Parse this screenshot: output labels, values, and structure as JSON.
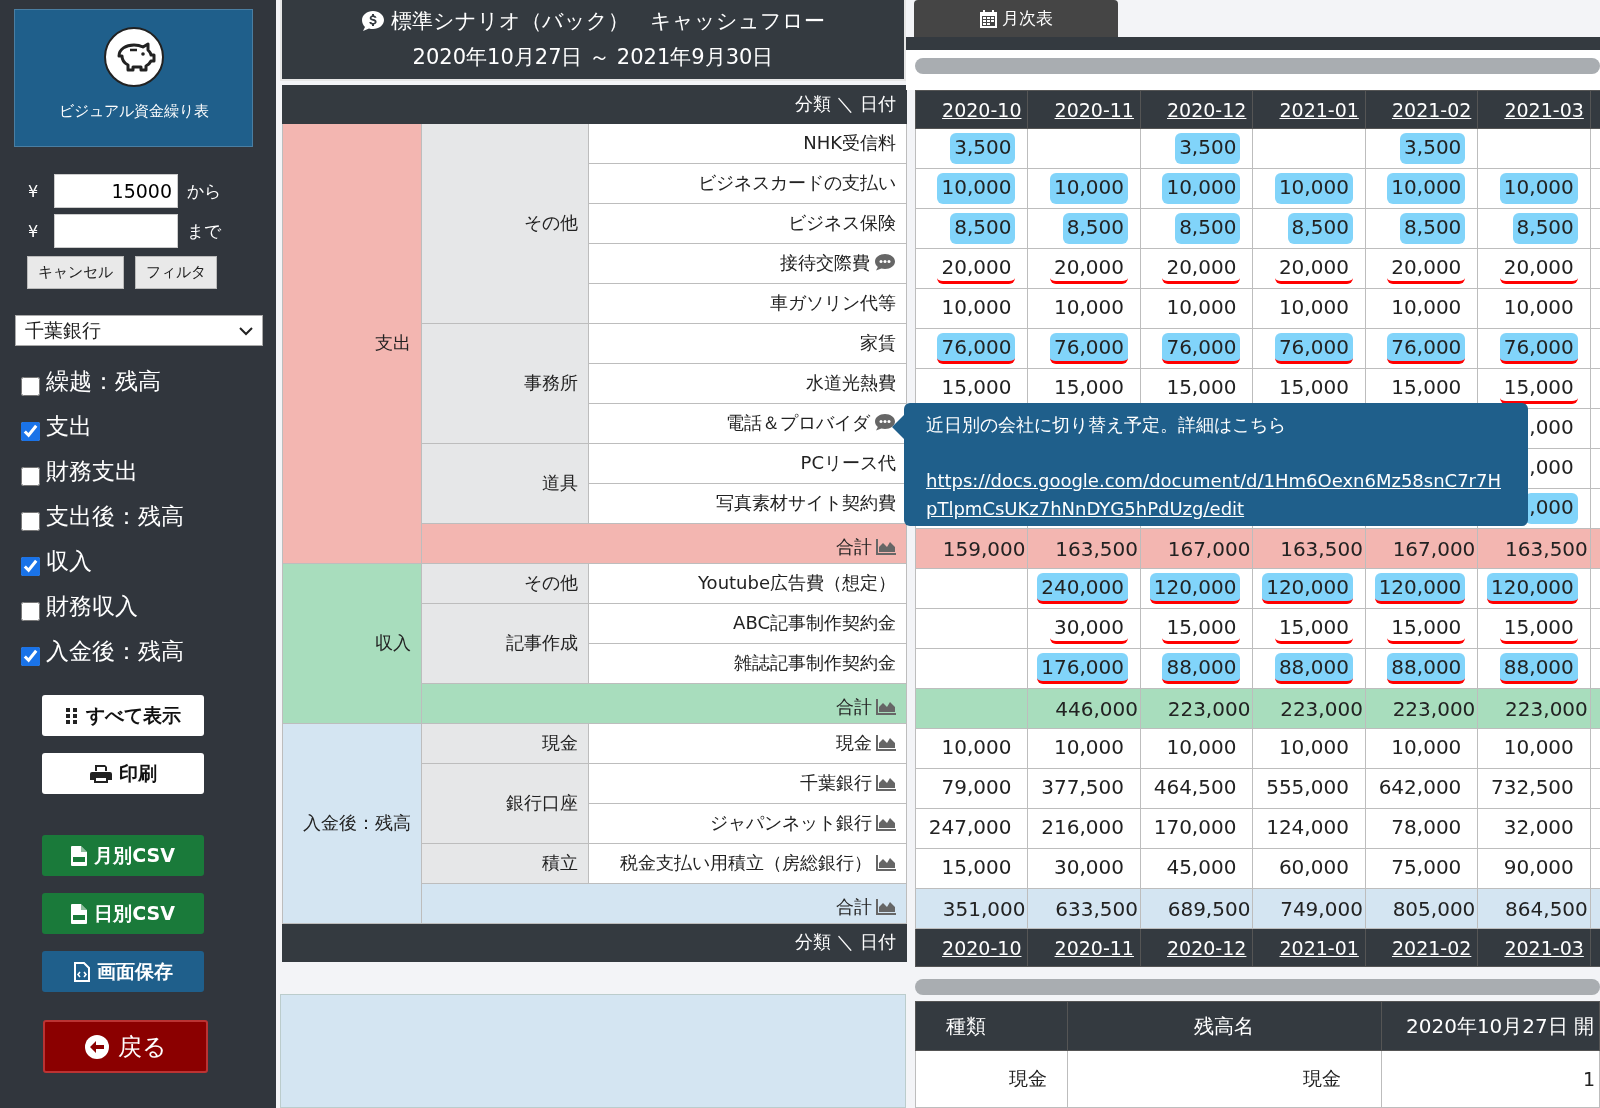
{
  "sidebar": {
    "logo": {
      "title": "ビジュアル資金繰り表"
    },
    "filter": {
      "fields": [
        {
          "currency": "¥",
          "value": "15000",
          "suffix": "から"
        },
        {
          "currency": "¥",
          "suffix": "まで"
        }
      ],
      "buttons": [
        "キャンセル",
        "フィルタ"
      ]
    },
    "account_select": {
      "value": "千葉銀行"
    },
    "checkboxes": [
      {
        "label": "繰越：残高",
        "checked": false
      },
      {
        "label": "支出",
        "checked": true
      },
      {
        "label": "財務支出",
        "checked": false
      },
      {
        "label": "支出後：残高",
        "checked": false
      },
      {
        "label": "収入",
        "checked": true
      },
      {
        "label": "財務収入",
        "checked": false
      },
      {
        "label": "入金後：残高",
        "checked": true
      }
    ],
    "actions": [
      {
        "label": "すべて表示",
        "kind": "light"
      },
      {
        "label": "印刷",
        "kind": "light"
      },
      {
        "label": "月別CSV",
        "kind": "success"
      },
      {
        "label": "日別CSV",
        "kind": "success"
      },
      {
        "label": "画面保存",
        "kind": "primary"
      }
    ],
    "back_button": {
      "label": "戻る"
    }
  },
  "header": {
    "title": "標準シナリオ（バック）　キャッシュフロー",
    "period": "2020年10月27日 ～ 2021年9月30日"
  },
  "tabs": [
    {
      "label": "月次表",
      "selected": true
    }
  ],
  "table": {
    "corner": "分類 ＼ 日付",
    "columns": [
      "2020-10",
      "2020-11",
      "2020-12",
      "2021-01",
      "2021-02",
      "2021-03"
    ],
    "footer_corner": "分類 ＼ 日付",
    "footer_columns": [
      "2020-10",
      "2020-11",
      "2020-12",
      "2021-01",
      "2021-02",
      "2021-03"
    ],
    "sections": [
      {
        "label": "支出",
        "kind": "expense",
        "groups": [
          {
            "label": "その他",
            "items": [
              {
                "label": "NHK受信料",
                "cells": [
                  {
                    "text": "3,500",
                    "highlighted": true,
                    "underlined": false
                  },
                  null,
                  {
                    "text": "3,500",
                    "highlighted": true,
                    "underlined": false
                  },
                  null,
                  {
                    "text": "3,500",
                    "highlighted": true,
                    "underlined": false
                  },
                  null
                ]
              },
              {
                "label": "ビジネスカードの支払い",
                "cells": [
                  {
                    "text": "10,000",
                    "highlighted": true,
                    "underlined": false
                  },
                  {
                    "text": "10,000",
                    "highlighted": true,
                    "underlined": false
                  },
                  {
                    "text": "10,000",
                    "highlighted": true,
                    "underlined": false
                  },
                  {
                    "text": "10,000",
                    "highlighted": true,
                    "underlined": false
                  },
                  {
                    "text": "10,000",
                    "highlighted": true,
                    "underlined": false
                  },
                  {
                    "text": "10,000",
                    "highlighted": true,
                    "underlined": false
                  }
                ]
              },
              {
                "label": "ビジネス保険",
                "cells": [
                  {
                    "text": "8,500",
                    "highlighted": true,
                    "underlined": false
                  },
                  {
                    "text": "8,500",
                    "highlighted": true,
                    "underlined": false
                  },
                  {
                    "text": "8,500",
                    "highlighted": true,
                    "underlined": false
                  },
                  {
                    "text": "8,500",
                    "highlighted": true,
                    "underlined": false
                  },
                  {
                    "text": "8,500",
                    "highlighted": true,
                    "underlined": false
                  },
                  {
                    "text": "8,500",
                    "highlighted": true,
                    "underlined": false
                  }
                ]
              },
              {
                "label": "接待交際費",
                "kind": "comment",
                "cells": [
                  {
                    "text": "20,000",
                    "highlighted": false,
                    "underlined": true
                  },
                  {
                    "text": "20,000",
                    "highlighted": false,
                    "underlined": true
                  },
                  {
                    "text": "20,000",
                    "highlighted": false,
                    "underlined": true
                  },
                  {
                    "text": "20,000",
                    "highlighted": false,
                    "underlined": true
                  },
                  {
                    "text": "20,000",
                    "highlighted": false,
                    "underlined": true
                  },
                  {
                    "text": "20,000",
                    "highlighted": false,
                    "underlined": true
                  }
                ]
              },
              {
                "label": "車ガソリン代等",
                "cells": [
                  {
                    "text": "10,000",
                    "highlighted": false,
                    "underlined": false
                  },
                  {
                    "text": "10,000",
                    "highlighted": false,
                    "underlined": false
                  },
                  {
                    "text": "10,000",
                    "highlighted": false,
                    "underlined": false
                  },
                  {
                    "text": "10,000",
                    "highlighted": false,
                    "underlined": false
                  },
                  {
                    "text": "10,000",
                    "highlighted": false,
                    "underlined": false
                  },
                  {
                    "text": "10,000",
                    "highlighted": false,
                    "underlined": false
                  }
                ]
              }
            ]
          },
          {
            "label": "事務所",
            "items": [
              {
                "label": "家賃",
                "cells": [
                  {
                    "text": "76,000",
                    "highlighted": true,
                    "underlined": true
                  },
                  {
                    "text": "76,000",
                    "highlighted": true,
                    "underlined": true
                  },
                  {
                    "text": "76,000",
                    "highlighted": true,
                    "underlined": true
                  },
                  {
                    "text": "76,000",
                    "highlighted": true,
                    "underlined": true
                  },
                  {
                    "text": "76,000",
                    "highlighted": true,
                    "underlined": true
                  },
                  {
                    "text": "76,000",
                    "highlighted": true,
                    "underlined": true
                  }
                ]
              },
              {
                "label": "水道光熱費",
                "cells": [
                  {
                    "text": "15,000",
                    "highlighted": false,
                    "underlined": false
                  },
                  {
                    "text": "15,000",
                    "highlighted": false,
                    "underlined": false
                  },
                  {
                    "text": "15,000",
                    "highlighted": false,
                    "underlined": false
                  },
                  {
                    "text": "15,000",
                    "highlighted": false,
                    "underlined": false
                  },
                  {
                    "text": "15,000",
                    "highlighted": false,
                    "underlined": false
                  },
                  {
                    "text": "15,000",
                    "highlighted": false,
                    "underlined": true
                  }
                ]
              },
              {
                "label": "電話＆プロバイダ",
                "kind": "comment",
                "cells": [
                  null,
                  null,
                  null,
                  null,
                  null,
                  {
                    "text": ",000",
                    "highlighted": false,
                    "underlined": false
                  }
                ]
              }
            ]
          },
          {
            "label": "道具",
            "items": [
              {
                "label": "PCリース代",
                "cells": [
                  null,
                  null,
                  null,
                  null,
                  null,
                  {
                    "text": ",000",
                    "highlighted": false,
                    "underlined": false
                  }
                ]
              },
              {
                "label": "写真素材サイト契約費",
                "cells": [
                  null,
                  null,
                  null,
                  null,
                  null,
                  {
                    "text": ",000",
                    "highlighted": true,
                    "underlined": false
                  }
                ]
              }
            ]
          }
        ],
        "total": {
          "label": "合計",
          "cells": [
            "159,000",
            "163,500",
            "167,000",
            "163,500",
            "167,000",
            "163,500"
          ]
        }
      },
      {
        "label": "収入",
        "kind": "income",
        "groups": [
          {
            "label": "その他",
            "items": [
              {
                "label": "Youtube広告費（想定）",
                "cells": [
                  null,
                  {
                    "text": "240,000",
                    "highlighted": true,
                    "underlined": true
                  },
                  {
                    "text": "120,000",
                    "highlighted": true,
                    "underlined": true
                  },
                  {
                    "text": "120,000",
                    "highlighted": true,
                    "underlined": true
                  },
                  {
                    "text": "120,000",
                    "highlighted": true,
                    "underlined": true
                  },
                  {
                    "text": "120,000",
                    "highlighted": true,
                    "underlined": true
                  }
                ]
              }
            ]
          },
          {
            "label": "記事作成",
            "items": [
              {
                "label": "ABC記事制作契約金",
                "cells": [
                  null,
                  {
                    "text": "30,000",
                    "highlighted": false,
                    "underlined": true
                  },
                  {
                    "text": "15,000",
                    "highlighted": false,
                    "underlined": true
                  },
                  {
                    "text": "15,000",
                    "highlighted": false,
                    "underlined": true
                  },
                  {
                    "text": "15,000",
                    "highlighted": false,
                    "underlined": true
                  },
                  {
                    "text": "15,000",
                    "highlighted": false,
                    "underlined": true
                  }
                ]
              },
              {
                "label": "雑誌記事制作契約金",
                "cells": [
                  null,
                  {
                    "text": "176,000",
                    "highlighted": true,
                    "underlined": true
                  },
                  {
                    "text": "88,000",
                    "highlighted": true,
                    "underlined": true
                  },
                  {
                    "text": "88,000",
                    "highlighted": true,
                    "underlined": true
                  },
                  {
                    "text": "88,000",
                    "highlighted": true,
                    "underlined": true
                  },
                  {
                    "text": "88,000",
                    "highlighted": true,
                    "underlined": true
                  }
                ]
              }
            ]
          }
        ],
        "total": {
          "label": "合計",
          "cells": [
            null,
            "446,000",
            "223,000",
            "223,000",
            "223,000",
            "223,000"
          ]
        }
      },
      {
        "label": "入金後：残高",
        "kind": "balance",
        "groups": [
          {
            "label": "現金",
            "items": [
              {
                "label": "現金",
                "kind": "chart",
                "cells": [
                  {
                    "text": "10,000",
                    "highlighted": false,
                    "underlined": false
                  },
                  {
                    "text": "10,000",
                    "highlighted": false,
                    "underlined": false
                  },
                  {
                    "text": "10,000",
                    "highlighted": false,
                    "underlined": false
                  },
                  {
                    "text": "10,000",
                    "highlighted": false,
                    "underlined": false
                  },
                  {
                    "text": "10,000",
                    "highlighted": false,
                    "underlined": false
                  },
                  {
                    "text": "10,000",
                    "highlighted": false,
                    "underlined": false
                  }
                ]
              }
            ]
          },
          {
            "label": "銀行口座",
            "items": [
              {
                "label": "千葉銀行",
                "kind": "chart",
                "cells": [
                  {
                    "text": "79,000",
                    "highlighted": false,
                    "underlined": false
                  },
                  {
                    "text": "377,500",
                    "highlighted": false,
                    "underlined": false
                  },
                  {
                    "text": "464,500",
                    "highlighted": false,
                    "underlined": false
                  },
                  {
                    "text": "555,000",
                    "highlighted": false,
                    "underlined": false
                  },
                  {
                    "text": "642,000",
                    "highlighted": false,
                    "underlined": false
                  },
                  {
                    "text": "732,500",
                    "highlighted": false,
                    "underlined": false
                  }
                ]
              },
              {
                "label": "ジャパンネット銀行",
                "kind": "chart",
                "cells": [
                  {
                    "text": "247,000",
                    "highlighted": false,
                    "underlined": false
                  },
                  {
                    "text": "216,000",
                    "highlighted": false,
                    "underlined": false
                  },
                  {
                    "text": "170,000",
                    "highlighted": false,
                    "underlined": false
                  },
                  {
                    "text": "124,000",
                    "highlighted": false,
                    "underlined": false
                  },
                  {
                    "text": "78,000",
                    "highlighted": false,
                    "underlined": false
                  },
                  {
                    "text": "32,000",
                    "highlighted": false,
                    "underlined": false
                  }
                ]
              }
            ]
          },
          {
            "label": "積立",
            "items": [
              {
                "label": "税金支払い用積立（房総銀行）",
                "kind": "chart",
                "cells": [
                  {
                    "text": "15,000",
                    "highlighted": false,
                    "underlined": false
                  },
                  {
                    "text": "30,000",
                    "highlighted": false,
                    "underlined": false
                  },
                  {
                    "text": "45,000",
                    "highlighted": false,
                    "underlined": false
                  },
                  {
                    "text": "60,000",
                    "highlighted": false,
                    "underlined": false
                  },
                  {
                    "text": "75,000",
                    "highlighted": false,
                    "underlined": false
                  },
                  {
                    "text": "90,000",
                    "highlighted": false,
                    "underlined": false
                  }
                ]
              }
            ]
          }
        ],
        "total": {
          "label": "合計",
          "cells": [
            "351,000",
            "633,500",
            "689,500",
            "749,000",
            "805,000",
            "864,500"
          ]
        }
      }
    ]
  },
  "tooltip": {
    "text": "近日別の会社に切り替え予定。詳細はこちら",
    "link": "https://docs.google.com/document/d/1Hm6Oexn6Mz58snC7r7HpTlpmCsUKz7hNnDYG5hPdUzg/edit"
  },
  "balance_table": {
    "columns": [
      "種類",
      "残高名",
      "2020年10月27日 開"
    ],
    "rows": [
      [
        "現金",
        "現金",
        "1"
      ]
    ]
  }
}
